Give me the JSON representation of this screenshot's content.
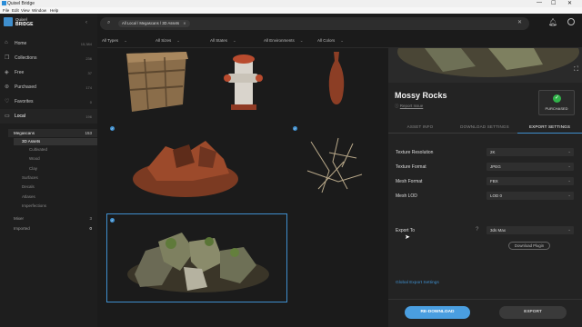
{
  "window": {
    "title": "Quixel Bridge",
    "min": "—",
    "max": "☐",
    "close": "✕"
  },
  "menu": [
    "File",
    "Edit",
    "View",
    "Window",
    "Help"
  ],
  "sidebar": {
    "brand_top": "Quixel",
    "brand_bottom": "BRIDGE",
    "items": [
      {
        "label": "Home",
        "count": "15,384"
      },
      {
        "label": "Collections",
        "count": "236"
      },
      {
        "label": "Free",
        "count": "37"
      },
      {
        "label": "Purchased",
        "count": "174"
      },
      {
        "label": "Favorites",
        "count": "0"
      },
      {
        "label": "Local",
        "count": "196"
      }
    ],
    "tree": [
      {
        "label": "Megascans",
        "count": "153"
      },
      {
        "label": "3D Assets",
        "count": ""
      },
      {
        "label": "Cultivated",
        "count": ""
      },
      {
        "label": "Wood",
        "count": ""
      },
      {
        "label": "Clay",
        "count": ""
      },
      {
        "label": "Surfaces",
        "count": ""
      },
      {
        "label": "Decals",
        "count": ""
      },
      {
        "label": "Atlases",
        "count": ""
      },
      {
        "label": "Imperfections",
        "count": ""
      },
      {
        "label": "Mixer",
        "count": "3"
      },
      {
        "label": "Imported",
        "count": "0"
      }
    ]
  },
  "search": {
    "chip": "All Local / Megascans / 3D Assets",
    "chip_close": "✕",
    "clear": "✕"
  },
  "filters": [
    "All Types",
    "All Sizes",
    "All States",
    "All Environments",
    "All Colors"
  ],
  "panel": {
    "title": "Mossy Rocks",
    "report": "Report Issue",
    "badge": "PURCHASED",
    "tabs": [
      "ASSET INFO",
      "DOWNLOAD SETTINGS",
      "EXPORT SETTINGS"
    ],
    "rows": [
      {
        "label": "Texture Resolution",
        "value": "2K"
      },
      {
        "label": "Texture Format",
        "value": "JPEG"
      },
      {
        "label": "Mesh Format",
        "value": "FBX"
      },
      {
        "label": "Mesh LOD",
        "value": "LOD 0"
      }
    ],
    "export_to": {
      "label": "Export To",
      "value": "3ds Max",
      "plugin_button": "Download Plugin"
    },
    "global_link": "Global Export Settings",
    "redownload": "RE-DOWNLOAD",
    "export": "EXPORT"
  },
  "colors": {
    "accent": "#3f8fce",
    "panel_bg": "#232323",
    "badge_green": "#31b34a"
  }
}
